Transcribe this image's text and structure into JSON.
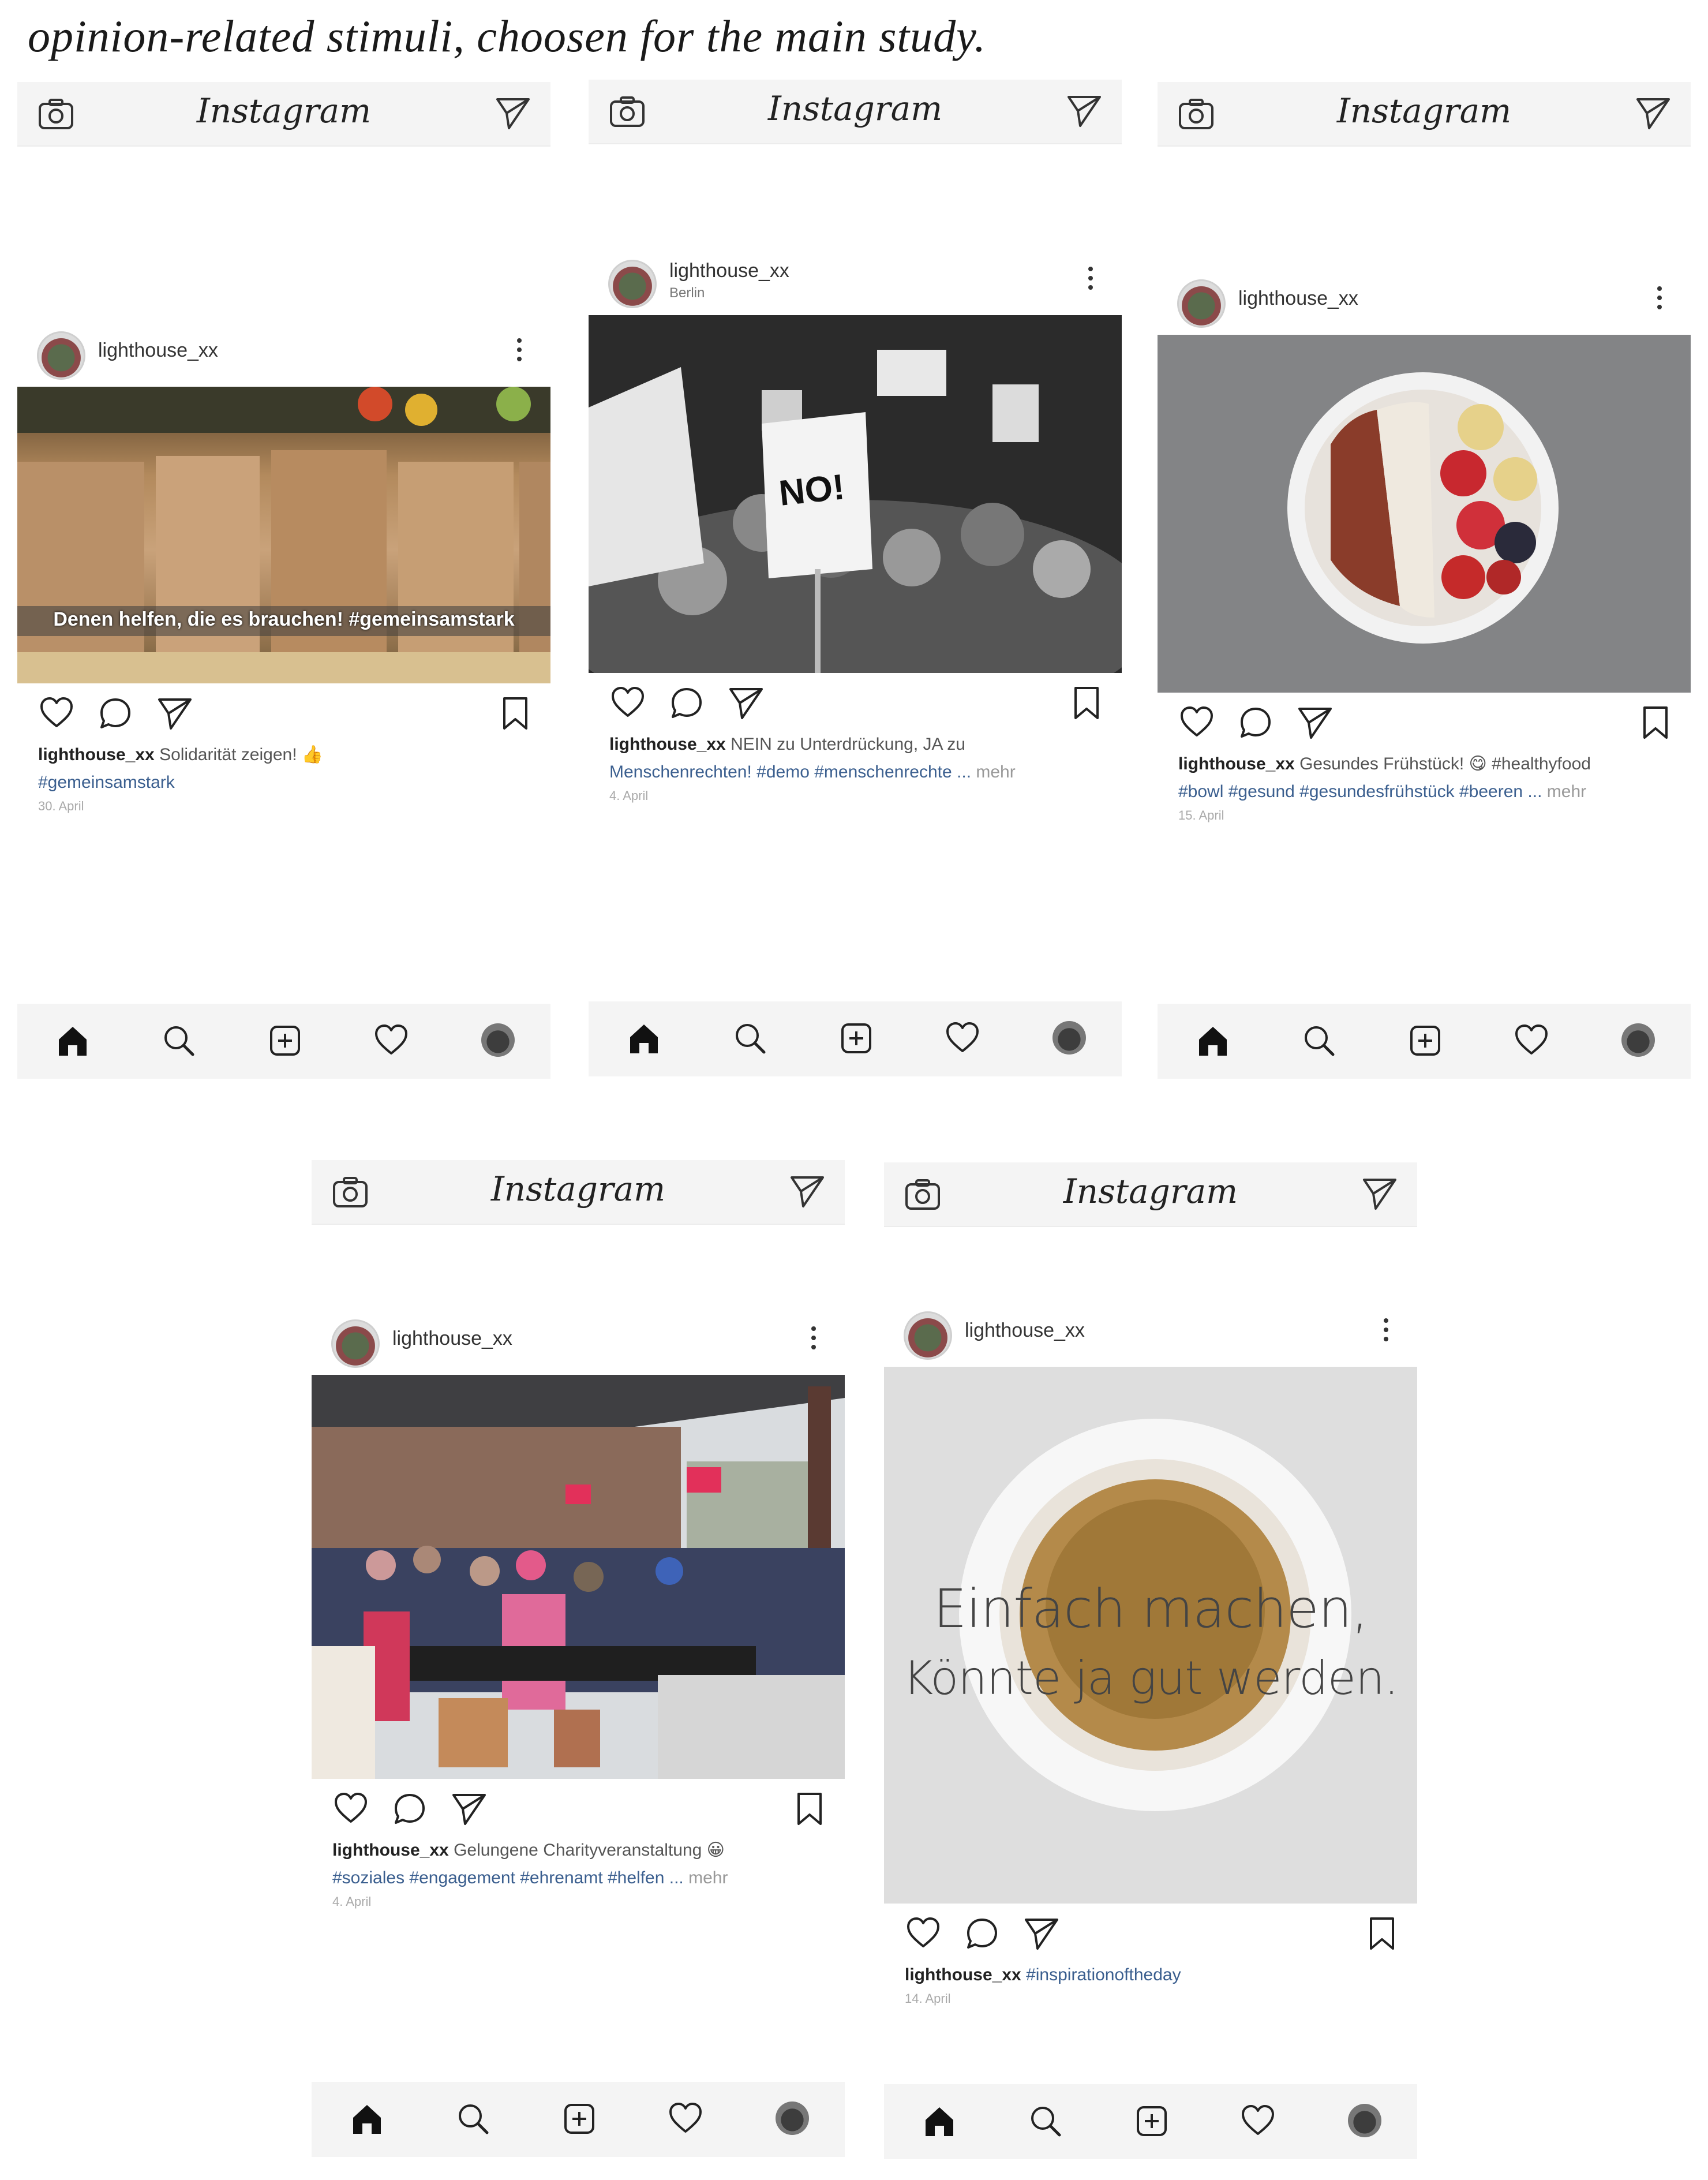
{
  "caption": "opinion-related stimuli, choosen for the main study.",
  "app": {
    "name": "Instagram"
  },
  "posts": [
    {
      "username": "lighthouse_xx",
      "location": "",
      "overlay_text": "Denen helfen, die es brauchen! #gemeinsamstark",
      "caption_user": "lighthouse_xx",
      "caption_text": "Solidarität zeigen! 👍",
      "caption_line2": "#gemeinsamstark",
      "more": "",
      "date": "30. April"
    },
    {
      "username": "lighthouse_xx",
      "location": "Berlin",
      "sign_text": "NO!",
      "caption_user": "lighthouse_xx",
      "caption_text": "NEIN zu Unterdrückung, JA zu",
      "caption_line2": "Menschenrechten! #demo #menschenrechte ...",
      "more": "mehr",
      "date": "4. April"
    },
    {
      "username": "lighthouse_xx",
      "location": "",
      "caption_user": "lighthouse_xx",
      "caption_text": "Gesundes Frühstück! 😋 #healthyfood",
      "caption_line2": "#bowl #gesund #gesundesfrühstück #beeren ...",
      "more": "mehr",
      "date": "15. April"
    },
    {
      "username": "lighthouse_xx",
      "location": "",
      "caption_user": "lighthouse_xx",
      "caption_text": "Gelungene Charityveranstaltung 😀",
      "caption_line2": "#soziales #engagement #ehrenamt #helfen ...",
      "more": "mehr",
      "date": "4. April"
    },
    {
      "username": "lighthouse_xx",
      "location": "",
      "quote_line1": "Einfach machen,",
      "quote_line2": "Könnte ja gut werden.",
      "caption_user": "lighthouse_xx",
      "caption_text": "#inspirationoftheday",
      "caption_line2": "",
      "more": "",
      "date": "14. April"
    }
  ],
  "icons": {
    "top_left": "camera-icon",
    "top_right": "direct-message-icon",
    "actions": [
      "heart-icon",
      "comment-icon",
      "share-icon",
      "bookmark-icon"
    ],
    "nav": [
      "home-icon",
      "search-icon",
      "add-post-icon",
      "activity-heart-icon",
      "profile-avatar"
    ]
  },
  "colors": {
    "hashtag": "#3b5f8f",
    "bar_background": "#f4f4f4"
  }
}
